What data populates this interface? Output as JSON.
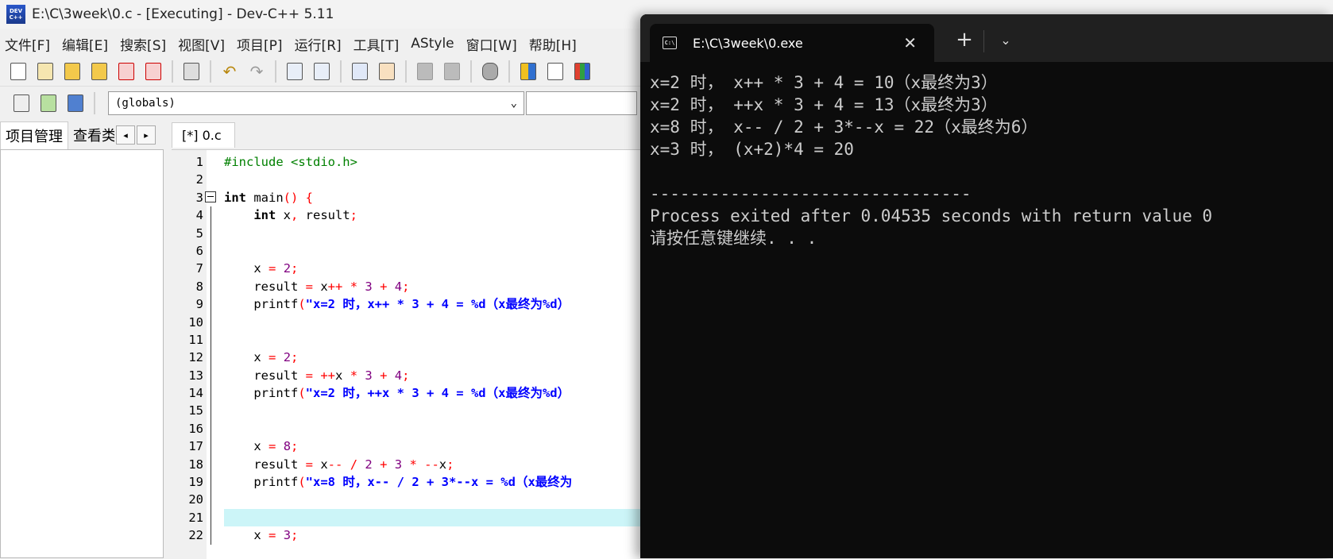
{
  "ide": {
    "title": "E:\\C\\3week\\0.c - [Executing] - Dev-C++ 5.11",
    "menu": [
      "文件[F]",
      "编辑[E]",
      "搜索[S]",
      "视图[V]",
      "项目[P]",
      "运行[R]",
      "工具[T]",
      "AStyle",
      "窗口[W]",
      "帮助[H]"
    ],
    "globals_combo": "(globals)",
    "left_tabs": [
      "项目管理",
      "查看类"
    ],
    "editor_tab": "[*] 0.c"
  },
  "code_lines": [
    {
      "n": "1"
    },
    {
      "n": "2"
    },
    {
      "n": "3"
    },
    {
      "n": "4"
    },
    {
      "n": "5"
    },
    {
      "n": "6"
    },
    {
      "n": "7"
    },
    {
      "n": "8"
    },
    {
      "n": "9"
    },
    {
      "n": "10"
    },
    {
      "n": "11"
    },
    {
      "n": "12"
    },
    {
      "n": "13"
    },
    {
      "n": "14"
    },
    {
      "n": "15"
    },
    {
      "n": "16"
    },
    {
      "n": "17"
    },
    {
      "n": "18"
    },
    {
      "n": "19"
    },
    {
      "n": "20"
    },
    {
      "n": "21"
    },
    {
      "n": "22"
    }
  ],
  "code": {
    "l1": [
      "#include <stdio.h>"
    ],
    "l3": [
      "int",
      " main",
      "()",
      " {"
    ],
    "l4": [
      "    ",
      "int",
      " x",
      ",",
      " result",
      ";"
    ],
    "l7": [
      "    x ",
      "=",
      " ",
      "2",
      ";"
    ],
    "l8": [
      "    result ",
      "=",
      " x",
      "++",
      " ",
      "*",
      " ",
      "3",
      " ",
      "+",
      " ",
      "4",
      ";"
    ],
    "l9": [
      "    printf",
      "(",
      "\"x=2 时，x++ * 3 + 4 = %d（x最终为%d）"
    ],
    "l12": [
      "    x ",
      "=",
      " ",
      "2",
      ";"
    ],
    "l13": [
      "    result ",
      "=",
      " ",
      "++",
      "x ",
      "*",
      " ",
      "3",
      " ",
      "+",
      " ",
      "4",
      ";"
    ],
    "l14": [
      "    printf",
      "(",
      "\"x=2 时，++x * 3 + 4 = %d（x最终为%d）"
    ],
    "l17": [
      "    x ",
      "=",
      " ",
      "8",
      ";"
    ],
    "l18": [
      "    result ",
      "=",
      " x",
      "--",
      " ",
      "/",
      " ",
      "2",
      " ",
      "+",
      " ",
      "3",
      " ",
      "*",
      " ",
      "--",
      "x",
      ";"
    ],
    "l19": [
      "    printf",
      "(",
      "\"x=8 时，x-- / 2 + 3*--x = %d（x最终为"
    ],
    "l22": [
      "    x ",
      "=",
      " ",
      "3",
      ";"
    ]
  },
  "terminal": {
    "tab_title": "E:\\C\\3week\\0.exe",
    "new_tab_symbol": "+",
    "dropdown_symbol": "⌄",
    "close_symbol": "✕",
    "lines": [
      "x=2 时， x++ * 3 + 4 = 10（x最终为3）",
      "x=2 时， ++x * 3 + 4 = 13（x最终为3）",
      "x=8 时， x-- / 2 + 3*--x = 22（x最终为6）",
      "x=3 时， (x+2)*4 = 20",
      "",
      "--------------------------------",
      "Process exited after 0.04535 seconds with return value 0",
      "请按任意键继续. . ."
    ]
  }
}
